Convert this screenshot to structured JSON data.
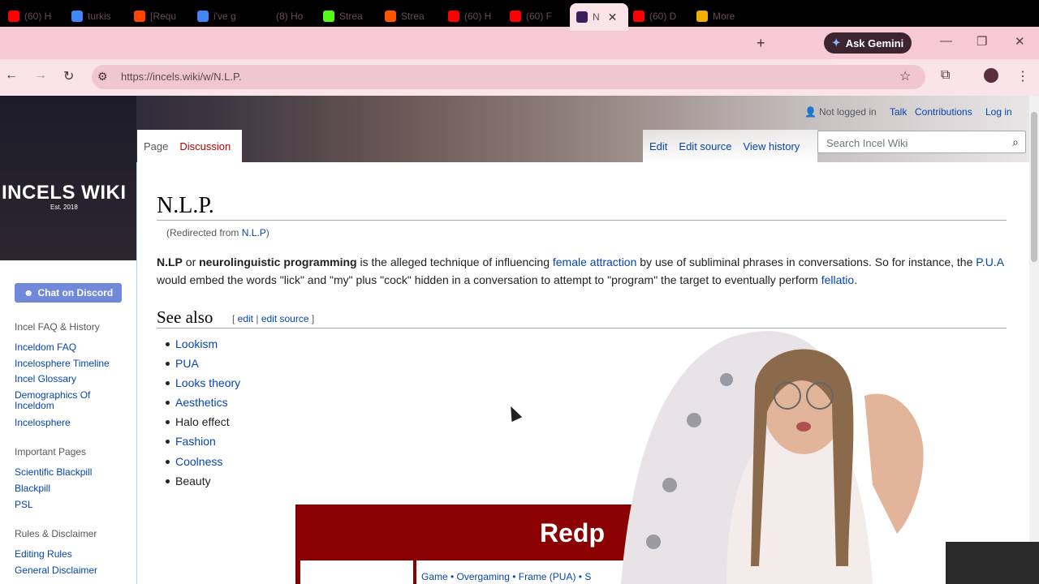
{
  "browser": {
    "tabs": [
      {
        "label": "(60) H",
        "favicon_color": "#ff0000"
      },
      {
        "label": "turkis",
        "favicon_color": "#4285f4"
      },
      {
        "label": "[Requ",
        "favicon_color": "#ff4500"
      },
      {
        "label": "i've g",
        "favicon_color": "#4285f4"
      },
      {
        "label": "(8) Ho",
        "favicon_color": "#000000"
      },
      {
        "label": "Strea",
        "favicon_color": "#53fc18"
      },
      {
        "label": "Strea",
        "favicon_color": "#ff5500"
      },
      {
        "label": "(60) H",
        "favicon_color": "#ff0000"
      },
      {
        "label": "(60) F",
        "favicon_color": "#ff0000"
      },
      {
        "label": "N",
        "favicon_color": "#3a1f5c"
      },
      {
        "label": "(60) D",
        "favicon_color": "#ff0000"
      },
      {
        "label": "More",
        "favicon_color": "#f0b000"
      }
    ],
    "new_tab": "+",
    "gemini_label": "Ask Gemini",
    "url": "https://incels.wiki/w/N.L.P."
  },
  "wiki": {
    "logo_title": "INCELS WIKI",
    "logo_sub": "Est. 2018",
    "tabs_left": [
      "Page",
      "Discussion"
    ],
    "tabs_right": [
      "Edit",
      "Edit source",
      "View history"
    ],
    "personal": {
      "not_logged": "Not logged in",
      "talk": "Talk",
      "contributions": "Contributions",
      "login": "Log in"
    },
    "search_placeholder": "Search Incel Wiki",
    "title": "N.L.P.",
    "redirect_prefix": "(Redirected from ",
    "redirect_link": "N.L.P",
    "redirect_suffix": ")",
    "para": {
      "b1": "N.LP",
      "t1": " or ",
      "b2": "neurolinguistic programming",
      "t2": " is the alleged technique of influencing ",
      "l1": "female attraction",
      "t3": " by use of subliminal phrases in conversations. So for instance, the ",
      "l2": "P.U.A",
      "t4": " would embed the words \"lick\" and \"my\" plus \"cock\" hidden in a conversation to attempt to \"program\" the target to eventually perform ",
      "l3": "fellatio",
      "t5": "."
    },
    "see_also": "See also",
    "edit_section": {
      "open": "[ ",
      "edit": "edit",
      "sep": " | ",
      "edit_source": "edit source",
      "close": " ]"
    },
    "see_also_items": [
      "Lookism",
      "PUA",
      "Looks theory",
      "Aesthetics",
      "Halo effect",
      "Fashion",
      "Coolness",
      "Beauty"
    ],
    "sidebar": {
      "discord": "Chat on Discord",
      "head1": "Incel FAQ & History",
      "links1": [
        "Inceldom FAQ",
        "Incelosphere Timeline",
        "Incel Glossary",
        "Demographics Of Inceldom",
        "Incelosphere"
      ],
      "head2": "Important Pages",
      "links2": [
        "Scientific Blackpill",
        "Blackpill",
        "PSL"
      ],
      "head3": "Rules & Disclaimer",
      "links3": [
        "Editing Rules",
        "General Disclaimer"
      ]
    },
    "navbox": {
      "title": "Redp",
      "links": "Game • Overgaming • Frame (PUA) • S"
    }
  }
}
